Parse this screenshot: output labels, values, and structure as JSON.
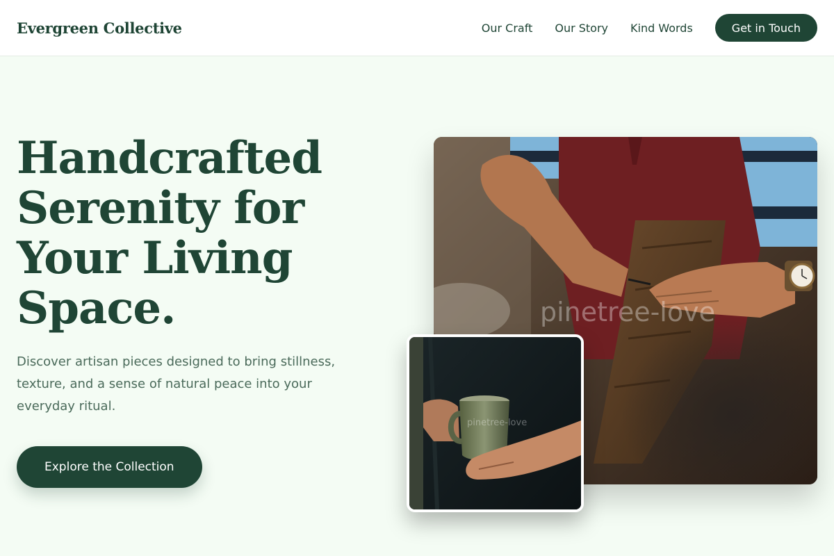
{
  "header": {
    "logo": "Evergreen Collective",
    "nav": [
      "Our Craft",
      "Our Story",
      "Kind Words"
    ],
    "cta": "Get in Touch"
  },
  "hero": {
    "title_lines": [
      "Handcrafted",
      "Serenity for",
      "Your Living",
      "Space."
    ],
    "subtitle": "Discover artisan pieces designed to bring stillness, texture, and a sense of natural peace into your everyday ritual.",
    "button": "Explore the Collection"
  },
  "images": {
    "main_watermark": "pinetree-love",
    "small_watermark": "pinetree-love"
  },
  "colors": {
    "brand": "#1f4535",
    "background": "#f4fcf4",
    "text_muted": "#4a6a5a"
  }
}
